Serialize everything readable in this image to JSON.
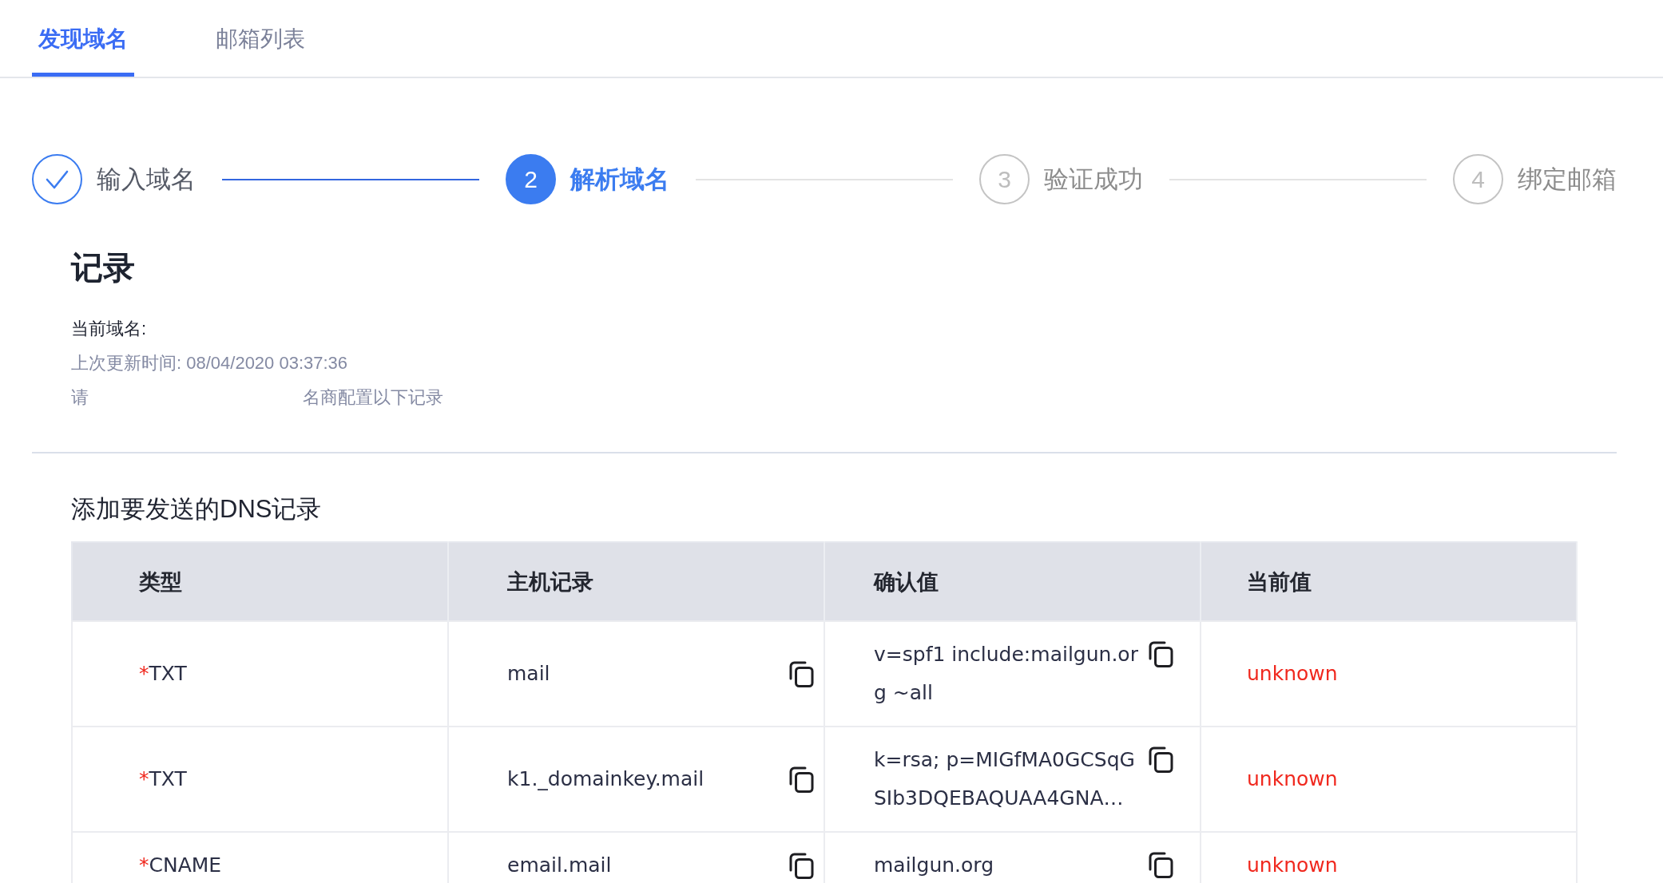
{
  "tabs": [
    {
      "label": "发现域名",
      "selected": true
    },
    {
      "label": "邮箱列表",
      "selected": false
    }
  ],
  "steps": [
    {
      "label": "输入域名",
      "completed": true,
      "selected": false
    },
    {
      "number": "2",
      "label": "解析域名",
      "completed": false,
      "selected": true
    },
    {
      "number": "3",
      "label": "验证成功",
      "completed": false,
      "selected": false
    },
    {
      "number": "4",
      "label": "绑定邮箱",
      "completed": false,
      "selected": false
    }
  ],
  "record": {
    "title": "记录",
    "domain_label": "当前域名:",
    "updated": "上次更新时间: 08/04/2020 03:37:36",
    "instruction_start": "请",
    "instruction_end": "名商配置以下记录"
  },
  "dns": {
    "title": "添加要发送的DNS记录",
    "columns": [
      "类型",
      "主机记录",
      "确认值",
      "当前值"
    ],
    "rows": [
      {
        "required_mark": "*",
        "type": "TXT",
        "host": "mail",
        "value": "v=spf1 include:mailgun.org ~all",
        "current": "unknown"
      },
      {
        "required_mark": "*",
        "type": "TXT",
        "host": "k1._domainkey.mail",
        "value": "k=rsa; p=MIGfMA0GCSqGSIb3DQEBAQUAA4GNA…",
        "current": "unknown"
      },
      {
        "required_mark": "*",
        "type": "CNAME",
        "host": "email.mail",
        "value": "mailgun.org",
        "current": "unknown"
      }
    ]
  }
}
